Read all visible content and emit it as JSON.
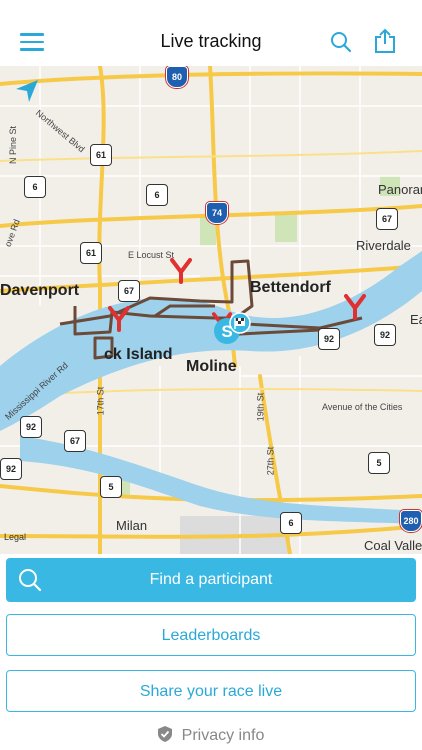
{
  "header": {
    "title": "Live tracking"
  },
  "map": {
    "cities": [
      "Davenport",
      "Bettendorf",
      "Moline",
      "ck Island",
      "Milan",
      "Coal Valley",
      "Riverdale",
      "Panoran",
      "Ea"
    ],
    "streets": [
      "E Locust St",
      "Northwest Blvd",
      "N Pine St",
      "ove Rd",
      "17th St",
      "19th St",
      "27th St",
      "Avenue of the Cities",
      "Mississippi River Rd"
    ],
    "shields": [
      "80",
      "61",
      "6",
      "6",
      "61",
      "67",
      "74",
      "67",
      "92",
      "92",
      "92",
      "67",
      "92",
      "5",
      "5",
      "6",
      "280"
    ],
    "legal": "Legal"
  },
  "actions": {
    "find": "Find a participant",
    "leaderboards": "Leaderboards",
    "share": "Share your race live",
    "privacy": "Privacy info"
  },
  "colors": {
    "accent": "#39b8e3",
    "route": "#6b4a3a",
    "marker": "#e0302f"
  },
  "icons": [
    "menu-icon",
    "search-icon",
    "share-icon",
    "location-arrow-icon",
    "start-marker-icon",
    "finish-flag-icon",
    "shield-check-icon"
  ]
}
